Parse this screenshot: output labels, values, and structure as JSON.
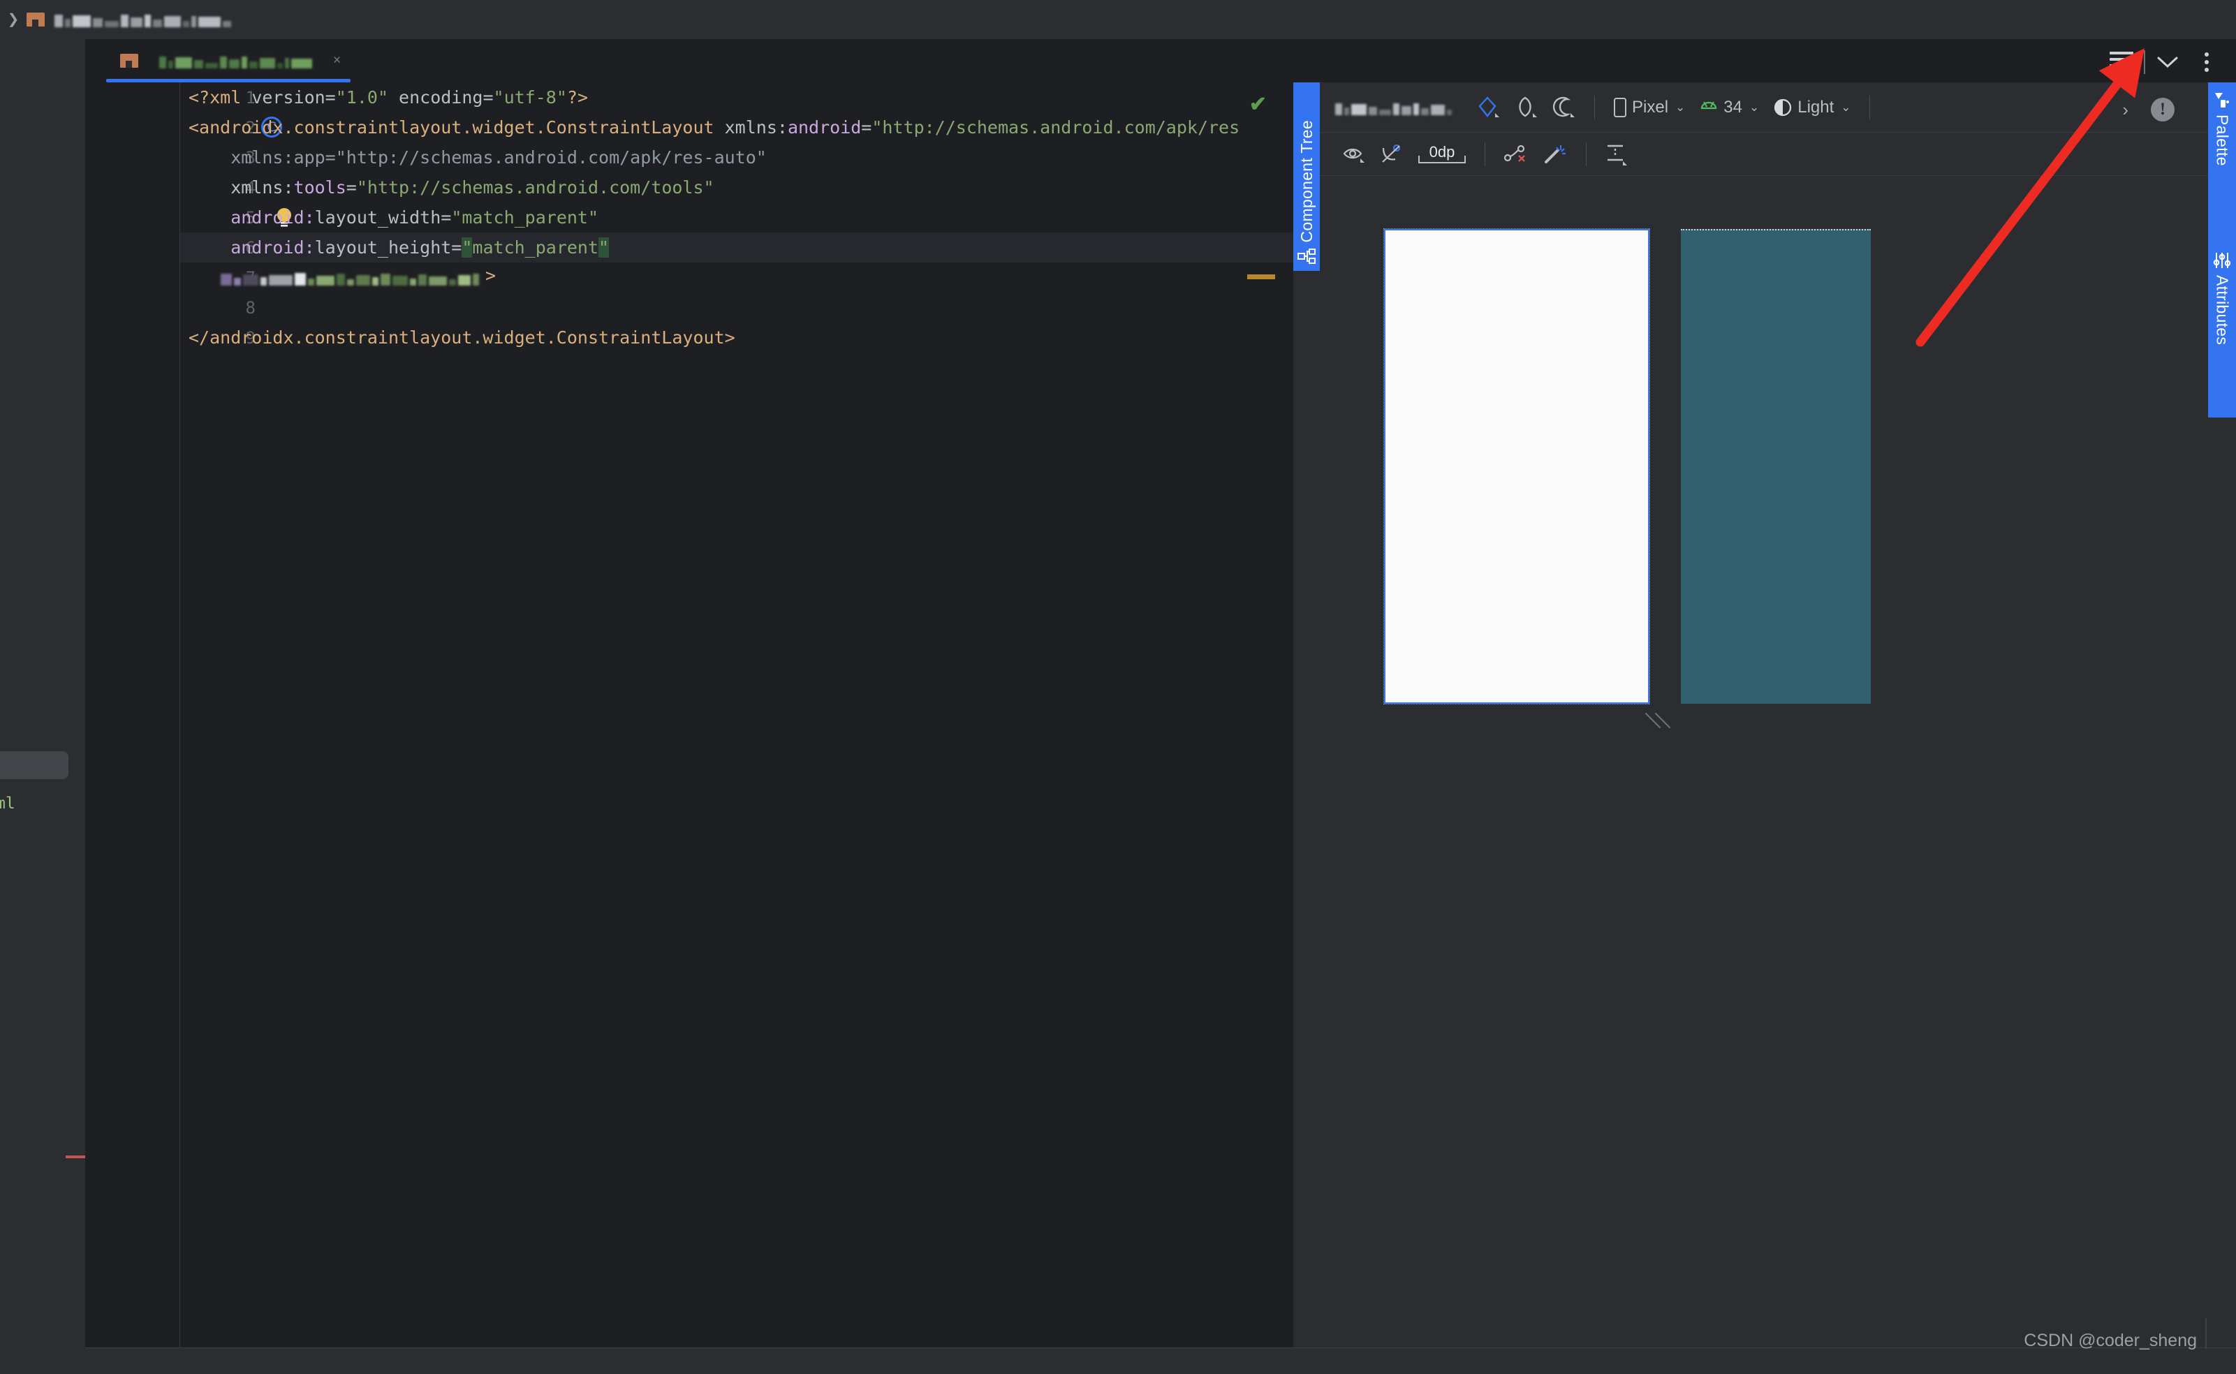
{
  "window": {
    "breadcrumb_redacted": true,
    "file_icon": "xml-file-icon"
  },
  "editor_tab": {
    "label_redacted": true,
    "close_label": "×",
    "active": true,
    "accent_color": "#3574f0"
  },
  "editor_controls": {
    "menu_label": "☰",
    "collapse_label": "⌄",
    "more_label": "⋮"
  },
  "code": {
    "language": "xml",
    "status_ok_mark": "✔",
    "lines": [
      {
        "number": "1",
        "tokens": [
          {
            "t": "<?xml ",
            "c": "s-tag"
          },
          {
            "t": "version",
            "c": "s-plain"
          },
          {
            "t": "=",
            "c": "s-punct"
          },
          {
            "t": "\"1.0\"",
            "c": "s-str"
          },
          {
            "t": " encoding",
            "c": "s-plain"
          },
          {
            "t": "=",
            "c": "s-punct"
          },
          {
            "t": "\"utf-8\"",
            "c": "s-str"
          },
          {
            "t": "?>",
            "c": "s-tag"
          }
        ]
      },
      {
        "number": "2",
        "gutter": "class-marker",
        "tokens": [
          {
            "t": "<androidx.constraintlayout.widget.ConstraintLayout",
            "c": "s-tag"
          },
          {
            "t": " xmlns:",
            "c": "s-plain"
          },
          {
            "t": "android",
            "c": "s-attr"
          },
          {
            "t": "=",
            "c": "s-punct"
          },
          {
            "t": "\"http://schemas.android.com/apk/res",
            "c": "s-str"
          }
        ]
      },
      {
        "number": "3",
        "tokens": [
          {
            "t": "    xmlns:app",
            "c": "s-lightg"
          },
          {
            "t": "=",
            "c": "s-lightg"
          },
          {
            "t": "\"http://schemas.android.com/apk/res-auto\"",
            "c": "s-lightg"
          }
        ]
      },
      {
        "number": "4",
        "tokens": [
          {
            "t": "    xmlns:",
            "c": "s-plain"
          },
          {
            "t": "tools",
            "c": "s-attr"
          },
          {
            "t": "=",
            "c": "s-punct"
          },
          {
            "t": "\"http://schemas.android.com/tools\"",
            "c": "s-str"
          }
        ]
      },
      {
        "number": "5",
        "gutter": "lightbulb",
        "tokens": [
          {
            "t": "    android:",
            "c": "s-attr"
          },
          {
            "t": "layout_width",
            "c": "s-plain"
          },
          {
            "t": "=",
            "c": "s-punct"
          },
          {
            "t": "\"match_parent\"",
            "c": "s-str"
          }
        ]
      },
      {
        "number": "6",
        "current": true,
        "tokens": [
          {
            "t": "    android:",
            "c": "s-attr"
          },
          {
            "t": "layout_height",
            "c": "s-plain"
          },
          {
            "t": "=",
            "c": "s-punct"
          },
          {
            "t": "\"",
            "c": "s-str sel"
          },
          {
            "t": "match_parent",
            "c": "s-str"
          },
          {
            "t": "\"",
            "c": "s-str sel"
          }
        ]
      },
      {
        "number": "7",
        "redacted": true,
        "tokens": []
      },
      {
        "number": "8",
        "tokens": []
      },
      {
        "number": "9",
        "tokens": [
          {
            "t": "</androidx.constraintlayout.widget.ConstraintLayout>",
            "c": "s-tag"
          }
        ]
      }
    ]
  },
  "component_tree_tab": {
    "label": "Component Tree",
    "icon": "component-tree-icon"
  },
  "design_toolbar": {
    "file_label_redacted": true,
    "mode_design": "design-mode-icon",
    "mode_blueprint": "blueprint-mode-icon",
    "mode_night": "night-mode-icon",
    "device": {
      "label": "Pixel",
      "icon": "phone-icon",
      "chevron": "⌄"
    },
    "api_level": {
      "label": "34",
      "icon": "android-robot-icon",
      "chevron": "⌄"
    },
    "theme": {
      "label": "Light",
      "icon": "contrast-icon",
      "chevron": "⌄"
    },
    "overflow_chevron": "›",
    "warning_icon": "warning-icon",
    "warning_glyph": "!"
  },
  "design_toolbar2": {
    "view_options": "eye-icon",
    "constraints_toggle": "hide-constraints-icon",
    "default_margin": "0dp",
    "clear_constraints": "clear-constraints-icon",
    "infer_constraints": "magic-wand-icon",
    "guidelines": "guidelines-icon",
    "help_glyph": "?"
  },
  "canvas": {
    "device_preview_bg": "#fafafa",
    "device_preview_border": "#3b78d8",
    "blueprint_bg": "#31606e",
    "canvas_bg": "#2b2d30",
    "resize_handle": "resize-handle-icon"
  },
  "right_tabs": [
    {
      "label": "Palette",
      "icon": "palette-icon"
    },
    {
      "label": "Attributes",
      "icon": "sliders-icon"
    }
  ],
  "annotation": {
    "type": "red-arrow",
    "color": "#ee2b22",
    "points_to": "editor-layout-menu-button"
  },
  "watermark": {
    "text": "CSDN @coder_sheng"
  },
  "status_bar": {
    "text_faint": true
  }
}
